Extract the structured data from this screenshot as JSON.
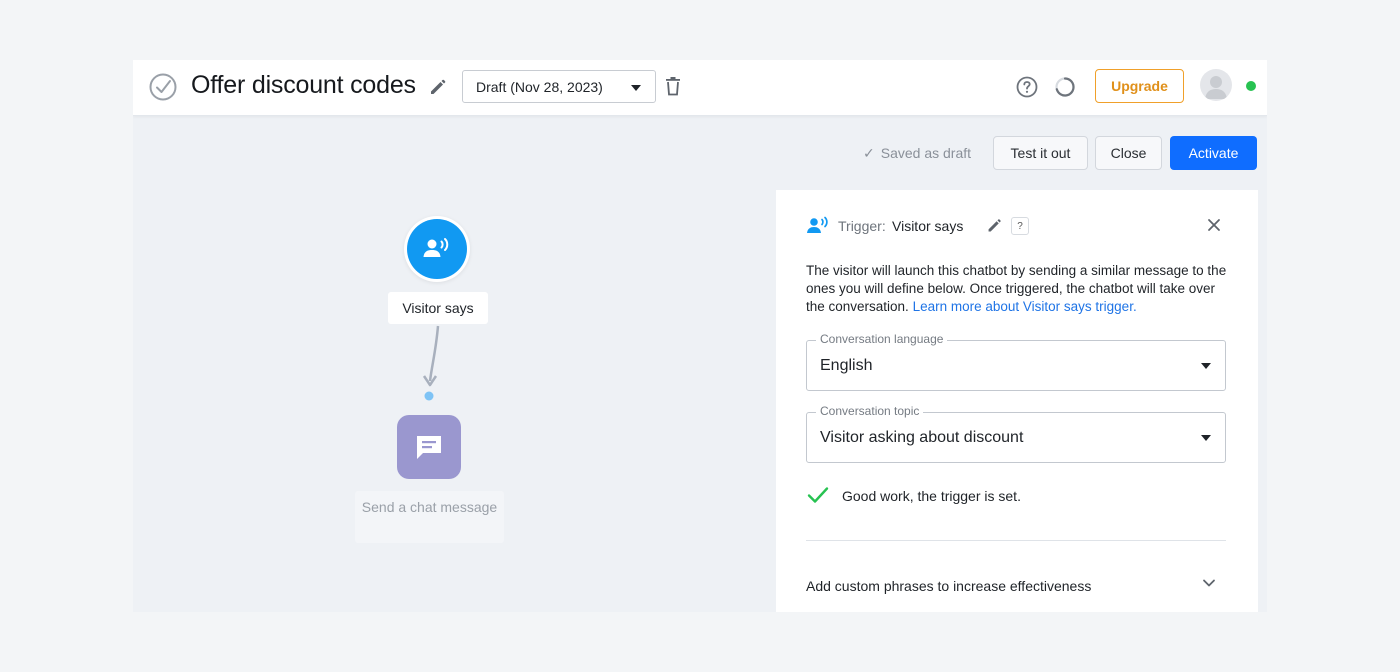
{
  "header": {
    "title": "Offer discount codes",
    "version_select_value": "Draft (Nov 28, 2023)",
    "upgrade_label": "Upgrade"
  },
  "actions": {
    "saved_status": "Saved as draft",
    "test_label": "Test it out",
    "close_label": "Close",
    "activate_label": "Activate"
  },
  "canvas": {
    "trigger_node_label": "Visitor says",
    "message_node_label": "Send a chat message"
  },
  "panel": {
    "heading_prefix": "Trigger:",
    "heading_value": "Visitor says",
    "help_glyph": "?",
    "description": "The visitor will launch this chatbot by sending a similar message to the ones you will define below. Once triggered, the chatbot will take over the conversation.",
    "learn_more_link": "Learn more about Visitor says trigger.",
    "language_field_label": "Conversation language",
    "language_value": "English",
    "topic_field_label": "Conversation topic",
    "topic_value": "Visitor asking about discount",
    "success_message": "Good work, the trigger is set.",
    "expander_label": "Add custom phrases to increase effectiveness"
  },
  "colors": {
    "accent": "#0f6dff",
    "upgrade": "#e0901a",
    "trigger_node": "#1199f2",
    "message_node": "#9a97cf",
    "success": "#27c251",
    "online": "#27c251"
  },
  "icons": [
    "check-circle-icon",
    "pencil-icon",
    "trash-icon",
    "help-circle-icon",
    "loader-icon",
    "avatar-icon",
    "visitor-speaking-icon",
    "chat-message-icon",
    "close-icon",
    "checkmark-icon",
    "chevron-down-icon"
  ]
}
